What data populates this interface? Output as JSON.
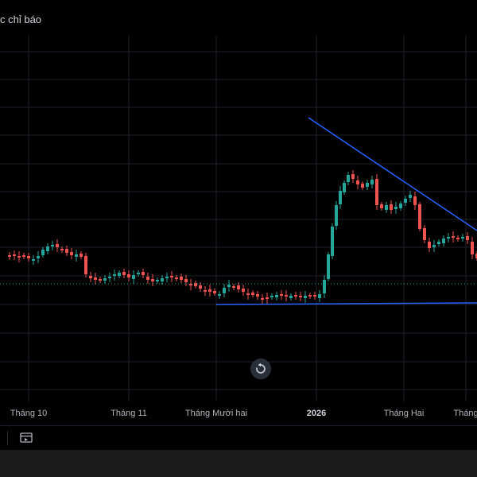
{
  "header": {
    "indicator_label": "c chỉ báo"
  },
  "time_axis": {
    "labels": [
      "Tháng 10",
      "Tháng 11",
      "Tháng Mười hai",
      "2026",
      "Tháng Hai",
      "Tháng"
    ]
  },
  "colors": {
    "up": "#26a69a",
    "down": "#ef5350",
    "trendline": "#2962ff",
    "price_line": "#26a69a",
    "grid": "#1e222d",
    "background": "#000000"
  },
  "icons": {
    "reset": "reset-view-icon",
    "replay": "replay-icon"
  }
}
